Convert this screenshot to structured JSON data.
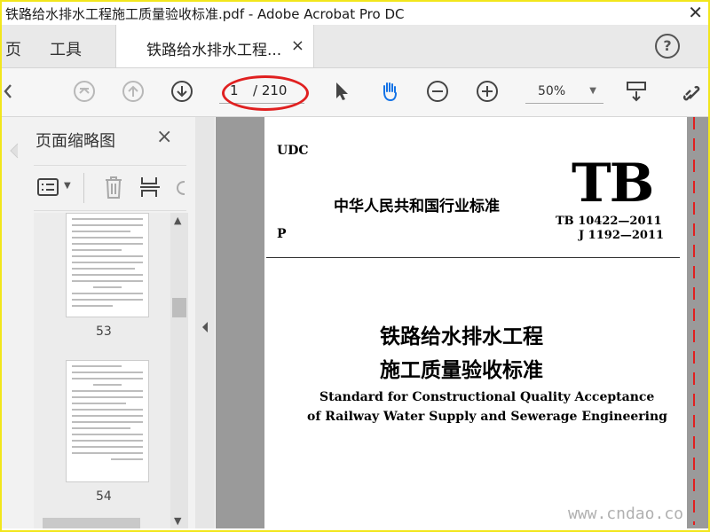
{
  "window": {
    "title": "铁路给水排水工程施工质量验收标准.pdf - Adobe Acrobat Pro DC"
  },
  "tabs": {
    "home_label": "页",
    "tools_label": "工具",
    "document_tab_label": "铁路给水排水工程...",
    "close_icon": "×",
    "help_icon": "?"
  },
  "toolbar": {
    "current_page": "1",
    "total_pages": "/ 210",
    "zoom": "50%"
  },
  "sidebar": {
    "title": "页面缩略图",
    "close_icon": "×",
    "thumbnails": [
      {
        "page_number": "53"
      },
      {
        "page_number": "54"
      }
    ]
  },
  "document": {
    "udc": "UDC",
    "standard_mark": "TB",
    "issuer": "中华人民共和国行业标准",
    "code_tb": "TB 10422—2011",
    "code_j": "J 1192—2011",
    "p_label": "P",
    "title_cn_line1": "铁路给水排水工程",
    "title_cn_line2": "施工质量验收标准",
    "title_en_line1": "Standard for Constructional Quality Acceptance",
    "title_en_line2": "of Railway Water Supply and Sewerage Engineering"
  },
  "watermark": "www.cndao.co",
  "colors": {
    "highlight_border": "#f2e61c",
    "annotation_red": "#e02020",
    "accent_blue": "#1473e6"
  }
}
